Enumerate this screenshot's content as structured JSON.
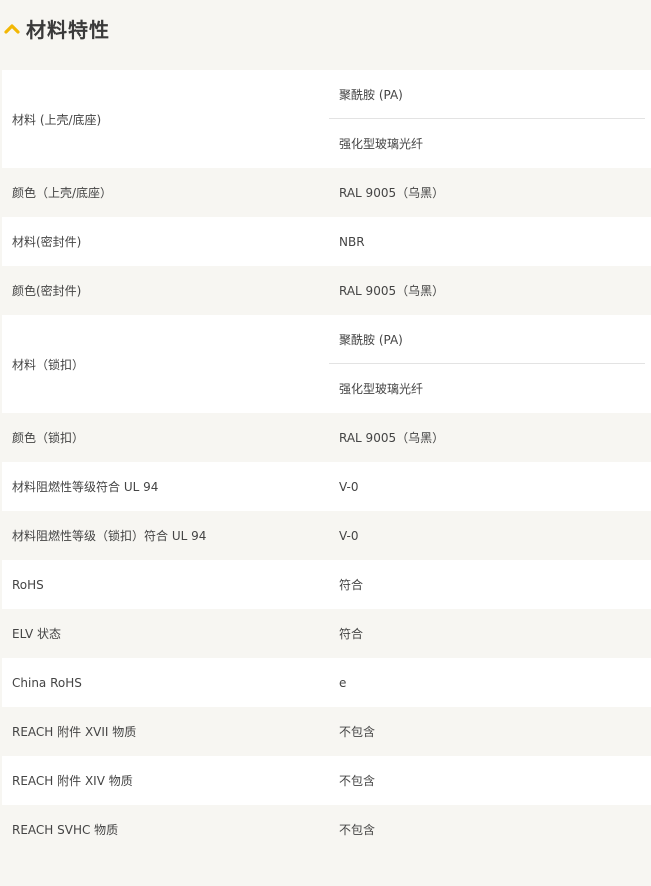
{
  "section": {
    "title": "材料特性",
    "icon": "chevron-up-icon",
    "accent_color": "#f2b705"
  },
  "rows": [
    {
      "label": "材料 (上壳/底座)",
      "values": [
        "聚酰胺 (PA)",
        "强化型玻璃光纤"
      ]
    },
    {
      "label": "颜色（上壳/底座）",
      "values": [
        "RAL 9005（乌黑）"
      ]
    },
    {
      "label": "材料(密封件)",
      "values": [
        "NBR"
      ]
    },
    {
      "label": "颜色(密封件)",
      "values": [
        "RAL 9005（乌黑）"
      ]
    },
    {
      "label": "材料（锁扣）",
      "values": [
        "聚酰胺 (PA)",
        "强化型玻璃光纤"
      ]
    },
    {
      "label": "颜色（锁扣）",
      "values": [
        "RAL 9005（乌黑）"
      ]
    },
    {
      "label": "材料阻燃性等级符合 UL 94",
      "values": [
        "V-0"
      ]
    },
    {
      "label": "材料阻燃性等级（锁扣）符合 UL 94",
      "values": [
        "V-0"
      ]
    },
    {
      "label": "RoHS",
      "values": [
        "符合"
      ]
    },
    {
      "label": "ELV 状态",
      "values": [
        "符合"
      ]
    },
    {
      "label": "China RoHS",
      "values": [
        "e"
      ]
    },
    {
      "label": "REACH 附件 XVII 物质",
      "values": [
        "不包含"
      ]
    },
    {
      "label": "REACH 附件 XIV 物质",
      "values": [
        "不包含"
      ]
    },
    {
      "label": "REACH SVHC 物质",
      "values": [
        "不包含"
      ]
    }
  ]
}
